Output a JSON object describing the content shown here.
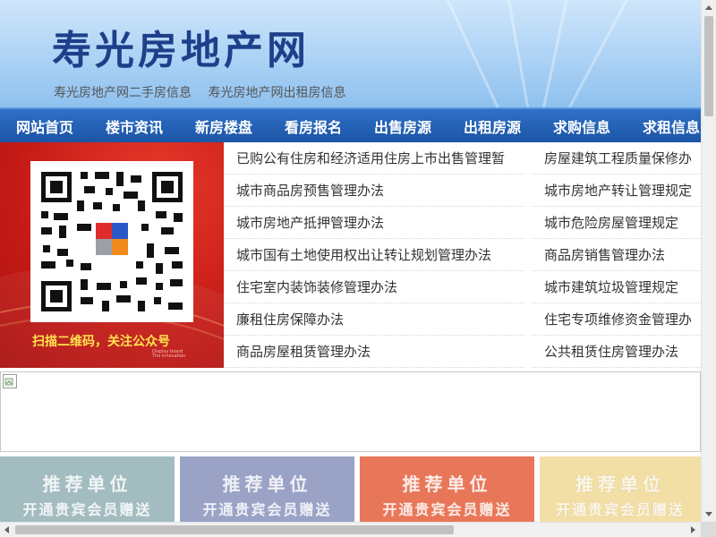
{
  "header": {
    "site_title": "寿光房地产网",
    "sublinks": [
      "寿光房地产网二手房信息",
      "寿光房地产网出租房信息"
    ]
  },
  "nav": {
    "items": [
      "网站首页",
      "楼市资讯",
      "新房楼盘",
      "看房报名",
      "出售房源",
      "出租房源",
      "求购信息",
      "求租信息"
    ]
  },
  "promo": {
    "caption": "扫描二维码，关注公众号",
    "small_text": [
      "Display board",
      "The innovation"
    ]
  },
  "links": {
    "left": [
      "已购公有住房和经济适用住房上市出售管理暂",
      "城市商品房预售管理办法",
      "城市房地产抵押管理办法",
      "城市国有土地使用权出让转让规划管理办法",
      "住宅室内装饰装修管理办法",
      "廉租住房保障办法",
      "商品房屋租赁管理办法"
    ],
    "right": [
      "房屋建筑工程质量保修办",
      "城市房地产转让管理规定",
      "城市危险房屋管理规定",
      "商品房销售管理办法",
      "城市建筑垃圾管理规定",
      "住宅专项维修资金管理办",
      "公共租赁住房管理办法"
    ]
  },
  "tiles": [
    {
      "line1": "推荐单位",
      "line2": "开通贵宾会员赠送",
      "bg": "#a3bcc0"
    },
    {
      "line1": "推荐单位",
      "line2": "开通贵宾会员赠送",
      "bg": "#9aa3c6"
    },
    {
      "line1": "推荐单位",
      "line2": "开通贵宾会员赠送",
      "bg": "#e8775a"
    },
    {
      "line1": "推荐单位",
      "line2": "开通贵宾会员赠送",
      "bg": "#f2dfa6"
    }
  ],
  "colors": {
    "nav_bg": "#1c55a6",
    "title": "#1e3f8a",
    "promo_red": "#c41a16",
    "caption_yellow": "#ffe34d"
  }
}
